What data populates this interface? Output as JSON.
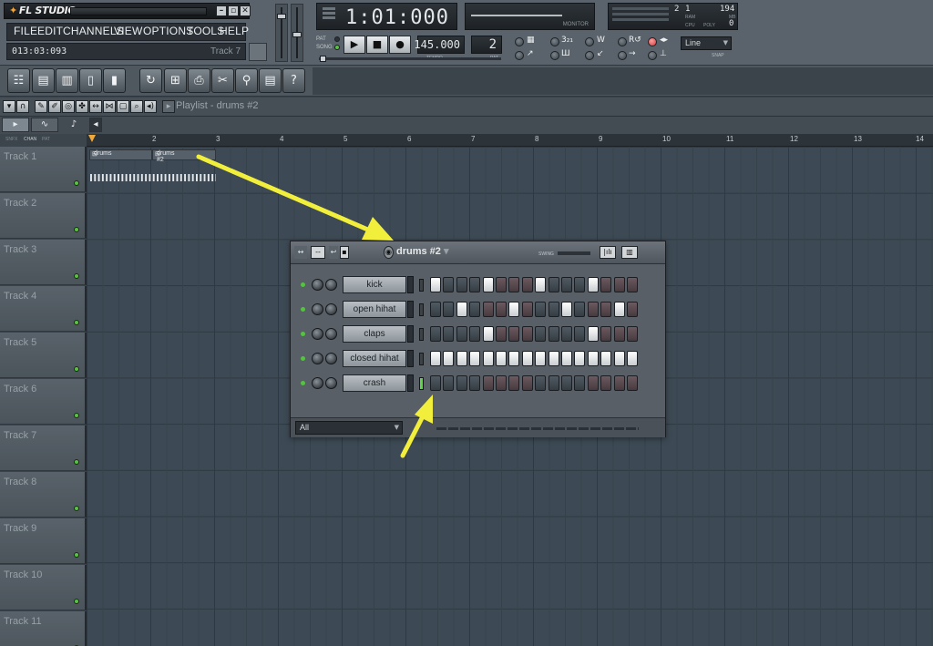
{
  "app": {
    "logo_text": "FL STUDIO",
    "menu": [
      "FILE",
      "EDIT",
      "CHANNELS",
      "VIEW",
      "OPTIONS",
      "TOOLS",
      "HELP"
    ],
    "hint_time": "013:03:093",
    "hint_track": "Track 7"
  },
  "transport": {
    "time_display": "1:01:000",
    "tempo": "145.000",
    "tempo_label": "TEMPO",
    "pattern": "2",
    "pattern_label": "PAT",
    "pat_label": "PAT",
    "song_label": "SONG",
    "monitor_label": "MONITOR",
    "snap": "Line",
    "snap_label": "SNAP"
  },
  "cpu": {
    "top_left": "2",
    "top_mid": "1",
    "top_right": "194",
    "ram_label": "RAM",
    "mb_label": "MB",
    "cpu_label": "CPU",
    "poly_label": "POLY",
    "poly_value": "0"
  },
  "playlist": {
    "title": "Playlist - drums #2",
    "ruler_left_labels": [
      "SNFX",
      "CHAN",
      "PAT"
    ],
    "ruler": [
      "2",
      "3",
      "4",
      "5",
      "6",
      "7",
      "8",
      "9",
      "10",
      "11",
      "12",
      "13",
      "14"
    ],
    "tracks": [
      "Track 1",
      "Track 2",
      "Track 3",
      "Track 4",
      "Track 5",
      "Track 6",
      "Track 7",
      "Track 8",
      "Track 9",
      "Track 10",
      "Track 11"
    ],
    "blocks": [
      {
        "label": "drums"
      },
      {
        "label": "drums #2"
      }
    ]
  },
  "step_sequencer": {
    "title": "drums #2",
    "swing_label": "SWING",
    "filter": "All",
    "channels": [
      {
        "name": "kick",
        "steps": [
          1,
          0,
          0,
          0,
          1,
          0,
          0,
          0,
          1,
          0,
          0,
          0,
          1,
          0,
          0,
          0
        ]
      },
      {
        "name": "open hihat",
        "steps": [
          0,
          0,
          1,
          0,
          0,
          0,
          1,
          0,
          0,
          0,
          1,
          0,
          0,
          0,
          1,
          0
        ]
      },
      {
        "name": "claps",
        "steps": [
          0,
          0,
          0,
          0,
          1,
          0,
          0,
          0,
          0,
          0,
          0,
          0,
          1,
          0,
          0,
          0
        ]
      },
      {
        "name": "closed hihat",
        "steps": [
          1,
          1,
          1,
          1,
          1,
          1,
          1,
          1,
          1,
          1,
          1,
          1,
          1,
          1,
          1,
          1
        ]
      },
      {
        "name": "crash",
        "steps": [
          0,
          0,
          0,
          0,
          0,
          0,
          0,
          0,
          0,
          0,
          0,
          0,
          0,
          0,
          0,
          0
        ]
      }
    ],
    "selected_channel": 4
  },
  "colors": {
    "arrow": "#f2ef3c",
    "led_green": "#59c441",
    "step_on": "#ffffff"
  }
}
